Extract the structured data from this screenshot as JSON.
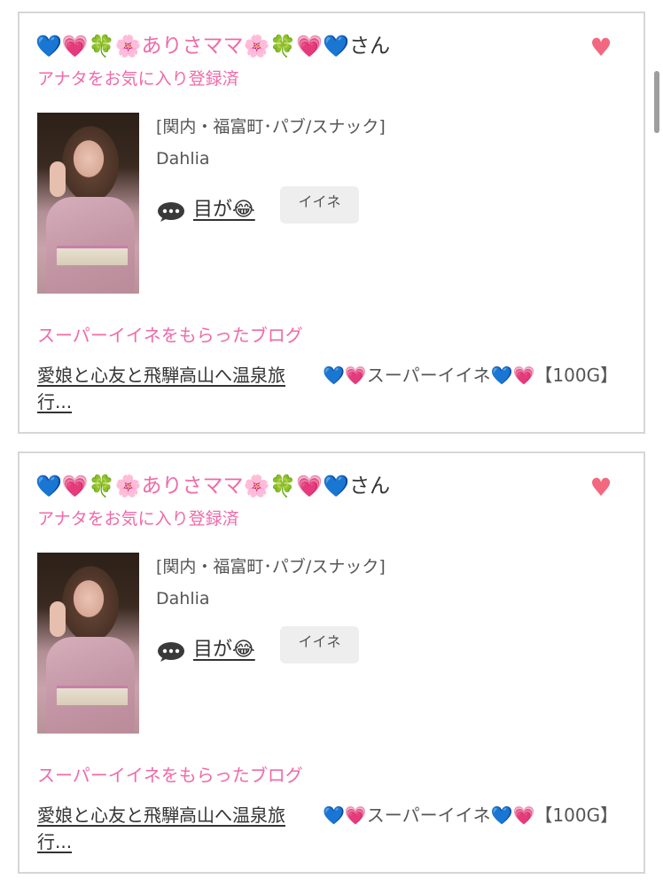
{
  "cards": [
    {
      "user_name": "ありさママ",
      "name_prefix_emoji": "💙💗🍀🌸",
      "name_suffix_emoji": "🌸🍀💗💙",
      "honorific": "さん",
      "favorite_icon": "heart-icon",
      "favorite_status": "アナタをお気に入り登録済",
      "shop_area": "[関内・福富町･パブ/スナック]",
      "shop_name": "Dahlia",
      "comment_text": "目が😂",
      "like_label": "イイネ",
      "blog_heading": "スーパーイイネをもらったブログ",
      "blog_title": "愛娘と心友と飛騨高山へ温泉旅行...",
      "super_like_text": "💙💗スーパーイイネ💙💗【100G】"
    },
    {
      "user_name": "ありさママ",
      "name_prefix_emoji": "💙💗🍀🌸",
      "name_suffix_emoji": "🌸🍀💗💙",
      "honorific": "さん",
      "favorite_icon": "heart-icon",
      "favorite_status": "アナタをお気に入り登録済",
      "shop_area": "[関内・福富町･パブ/スナック]",
      "shop_name": "Dahlia",
      "comment_text": "目が😂",
      "like_label": "イイネ",
      "blog_heading": "スーパーイイネをもらったブログ",
      "blog_title": "愛娘と心友と飛騨高山へ温泉旅行...",
      "super_like_text": "💙💗スーパーイイネ💙💗【100G】"
    }
  ],
  "colors": {
    "accent_pink": "#f06aa8",
    "heart": "#f3687f",
    "card_border": "#d6d6d6",
    "like_button_bg": "#eeeeee"
  }
}
